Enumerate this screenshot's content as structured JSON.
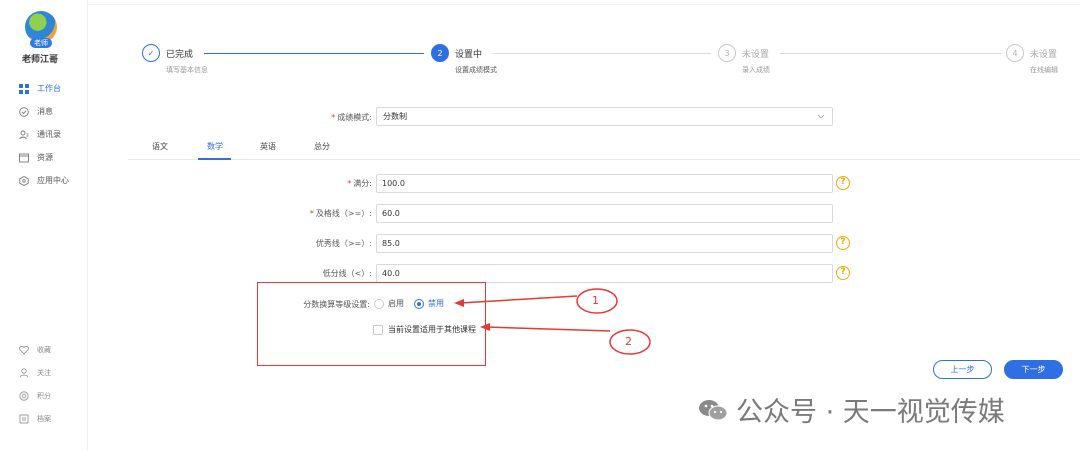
{
  "sidebar": {
    "avatar_badge": "老师",
    "user_name": "老师江哥",
    "items": [
      {
        "label": "工作台",
        "icon": "grid-icon",
        "active": true
      },
      {
        "label": "消息",
        "icon": "check-circle-icon",
        "active": false
      },
      {
        "label": "通讯录",
        "icon": "contacts-icon",
        "active": false
      },
      {
        "label": "资源",
        "icon": "folder-icon",
        "active": false
      },
      {
        "label": "应用中心",
        "icon": "hexagon-icon",
        "active": false
      }
    ],
    "bottom_items": [
      {
        "label": "收藏",
        "icon": "heart-icon"
      },
      {
        "label": "关注",
        "icon": "user-icon"
      },
      {
        "label": "积分",
        "icon": "coin-icon"
      },
      {
        "label": "档案",
        "icon": "archive-icon"
      }
    ]
  },
  "steps": [
    {
      "title": "已完成",
      "sub": "填写基本信息",
      "state": "done",
      "marker": "✓"
    },
    {
      "title": "设置中",
      "sub": "设置成绩模式",
      "state": "current",
      "marker": "2"
    },
    {
      "title": "未设置",
      "sub": "录入成绩",
      "state": "todo",
      "marker": "3"
    },
    {
      "title": "未设置",
      "sub": "在线编辑",
      "state": "todo",
      "marker": "4"
    }
  ],
  "mode": {
    "label": "成绩模式:",
    "value": "分数制"
  },
  "tabs": [
    {
      "label": "语文",
      "active": false
    },
    {
      "label": "数学",
      "active": true
    },
    {
      "label": "英语",
      "active": false
    },
    {
      "label": "总分",
      "active": false
    }
  ],
  "fields": {
    "full_score": {
      "label": "满分:",
      "value": "100.0",
      "required": true
    },
    "pass_line": {
      "label": "及格线（>=）:",
      "value": "60.0",
      "required": true
    },
    "excellent_line": {
      "label": "优秀线（>=）:",
      "value": "85.0",
      "required": false
    },
    "low_line": {
      "label": "低分线（<）:",
      "value": "40.0",
      "required": false
    }
  },
  "grade_conversion": {
    "label": "分数换算等级设置:",
    "options": [
      "启用",
      "禁用"
    ],
    "selected": "禁用"
  },
  "apply_all": {
    "label": "当前设置适用于其他课程",
    "checked": false
  },
  "annotations": {
    "one": "1",
    "two": "2"
  },
  "buttons": {
    "prev": "上一步",
    "next": "下一步"
  },
  "watermark": {
    "text": "公众号 · 天一视觉传媒"
  },
  "colors": {
    "accent": "#2f6fe4",
    "annotation": "#e53935",
    "help": "#f2a900"
  }
}
